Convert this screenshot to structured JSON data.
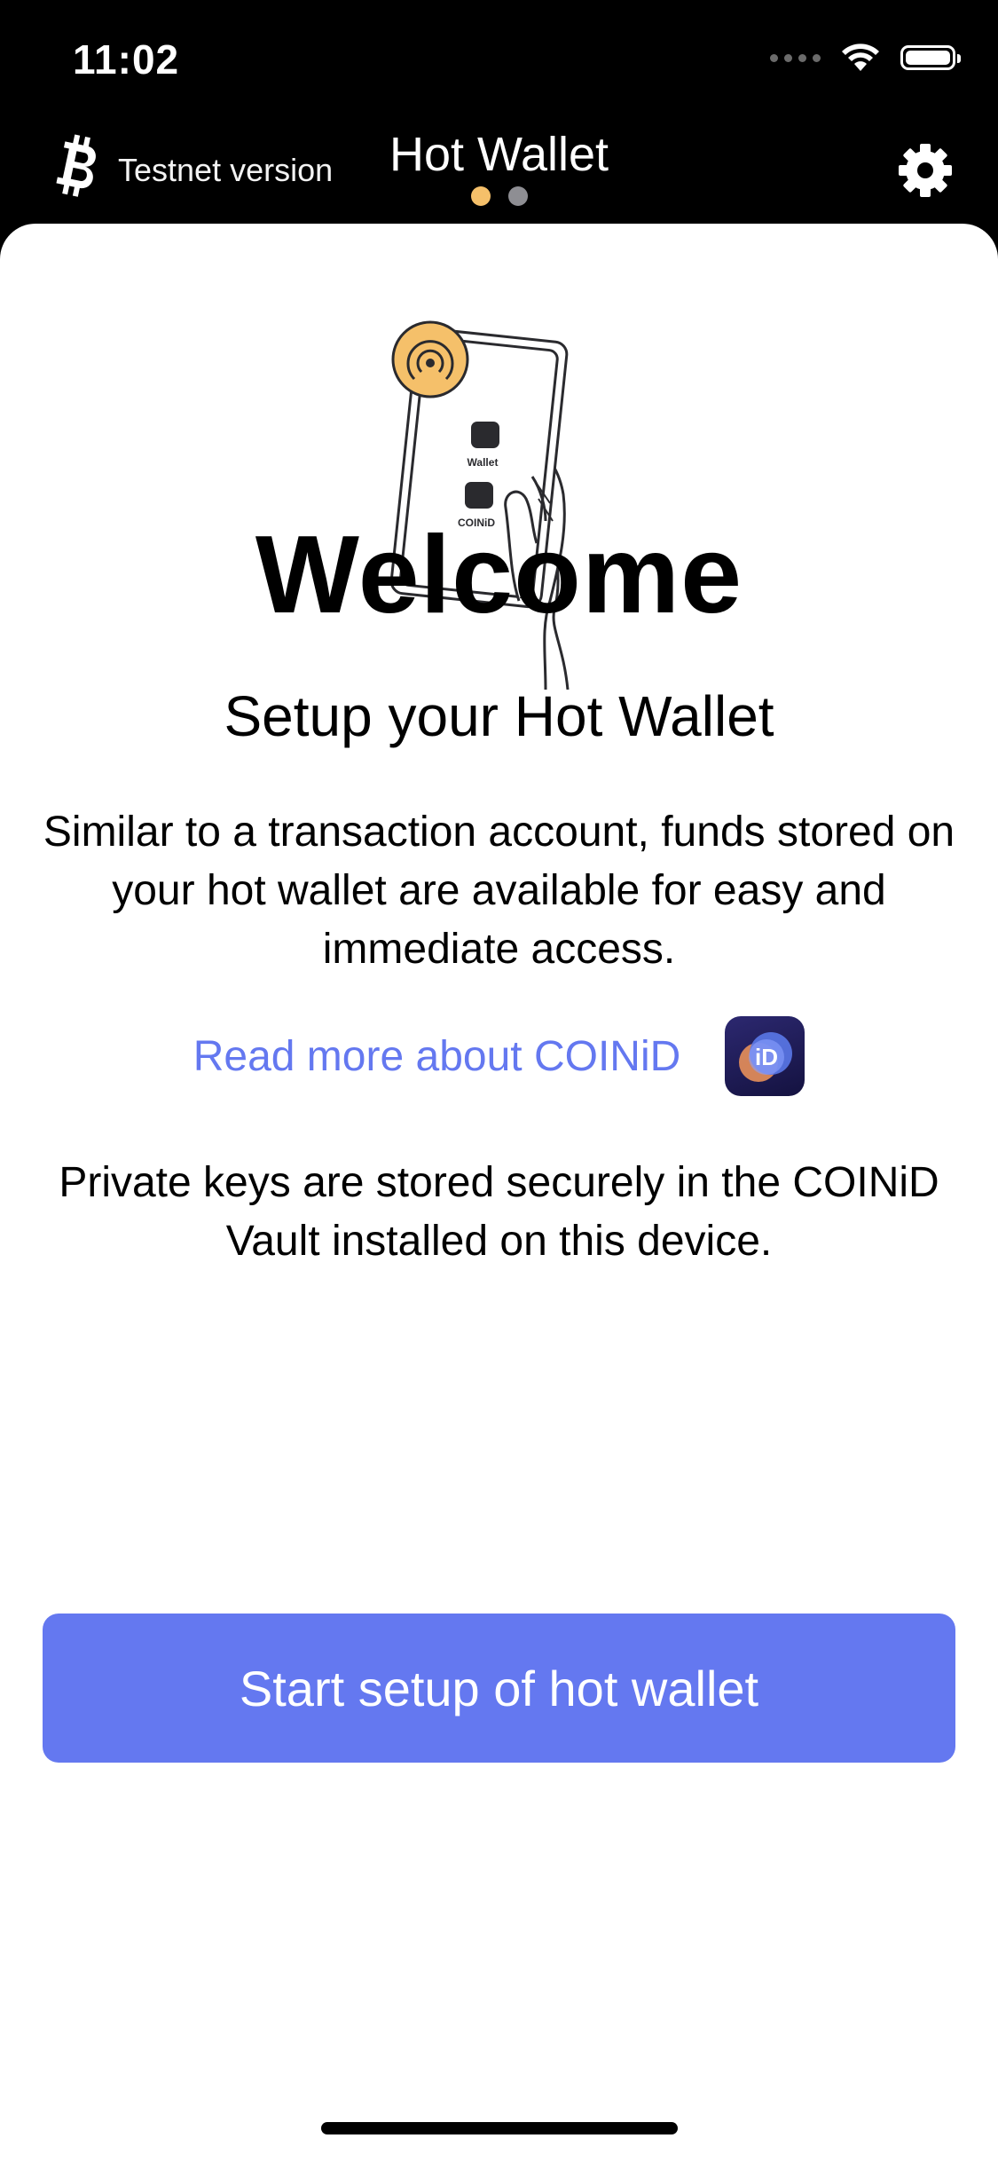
{
  "status_bar": {
    "time": "11:02"
  },
  "nav": {
    "network_label": "Testnet version",
    "title": "Hot Wallet",
    "page_dots": [
      {
        "active": true,
        "color": "#F5C06A"
      },
      {
        "active": false,
        "color": "#8E8E93"
      }
    ],
    "icons": {
      "left": "bitcoin-icon",
      "right": "gear-icon"
    }
  },
  "illustration": {
    "phone_labels": [
      "Wallet",
      "COINiD"
    ],
    "icon": "nfc-signal-icon"
  },
  "main": {
    "title": "Welcome",
    "subtitle": "Setup your Hot Wallet",
    "description": "Similar to a transaction account, funds stored on your hot wallet are available for easy and immediate access.",
    "read_more_link": "Read more about COINiD",
    "app_icon_text": "iD",
    "private_keys_text": "Private keys are stored securely in the COINiD Vault installed on this device."
  },
  "actions": {
    "start_button": "Start setup of hot wallet"
  },
  "colors": {
    "accent": "#6478F0",
    "orange": "#F5C06A",
    "background_dark": "#000000",
    "card": "#FFFFFF"
  }
}
